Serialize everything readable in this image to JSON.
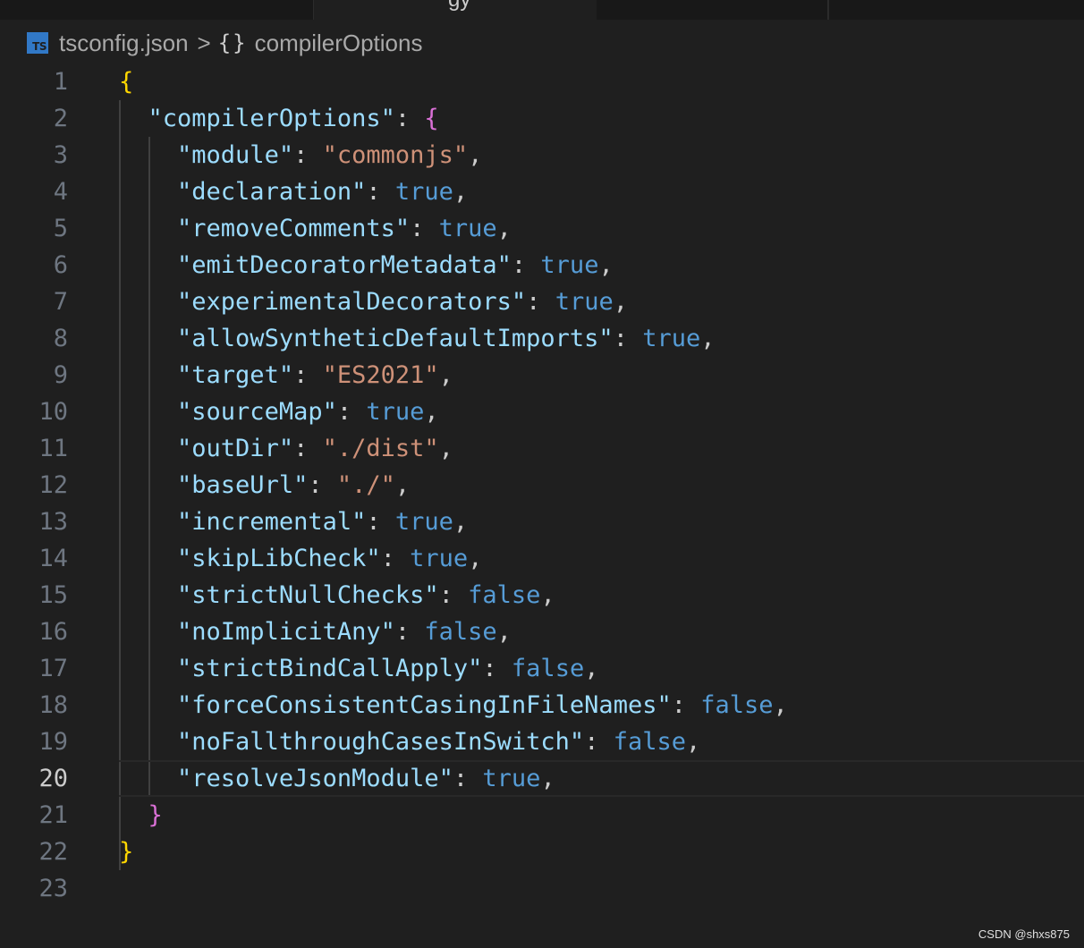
{
  "tabs": [
    {
      "label": "gy",
      "active": true
    }
  ],
  "breadcrumb": {
    "file_icon": "typescript-file-icon",
    "file_icon_text": "TS",
    "file": "tsconfig.json",
    "separator": ">",
    "symbol_icon": "braces-icon",
    "symbol_icon_text": "{}",
    "symbol": "compilerOptions"
  },
  "editor": {
    "current_line": 20,
    "lines": [
      {
        "number": "1",
        "tokens": [
          {
            "text": "{",
            "type": "b1"
          }
        ]
      },
      {
        "number": "2",
        "tokens": [
          {
            "text": "  ",
            "type": "punc"
          },
          {
            "text": "\"compilerOptions\"",
            "type": "key"
          },
          {
            "text": ": ",
            "type": "punc"
          },
          {
            "text": "{",
            "type": "b2"
          }
        ]
      },
      {
        "number": "3",
        "tokens": [
          {
            "text": "    ",
            "type": "punc"
          },
          {
            "text": "\"module\"",
            "type": "key"
          },
          {
            "text": ": ",
            "type": "punc"
          },
          {
            "text": "\"commonjs\"",
            "type": "str"
          },
          {
            "text": ",",
            "type": "punc"
          }
        ]
      },
      {
        "number": "4",
        "tokens": [
          {
            "text": "    ",
            "type": "punc"
          },
          {
            "text": "\"declaration\"",
            "type": "key"
          },
          {
            "text": ": ",
            "type": "punc"
          },
          {
            "text": "true",
            "type": "bool"
          },
          {
            "text": ",",
            "type": "punc"
          }
        ]
      },
      {
        "number": "5",
        "tokens": [
          {
            "text": "    ",
            "type": "punc"
          },
          {
            "text": "\"removeComments\"",
            "type": "key"
          },
          {
            "text": ": ",
            "type": "punc"
          },
          {
            "text": "true",
            "type": "bool"
          },
          {
            "text": ",",
            "type": "punc"
          }
        ]
      },
      {
        "number": "6",
        "tokens": [
          {
            "text": "    ",
            "type": "punc"
          },
          {
            "text": "\"emitDecoratorMetadata\"",
            "type": "key"
          },
          {
            "text": ": ",
            "type": "punc"
          },
          {
            "text": "true",
            "type": "bool"
          },
          {
            "text": ",",
            "type": "punc"
          }
        ]
      },
      {
        "number": "7",
        "tokens": [
          {
            "text": "    ",
            "type": "punc"
          },
          {
            "text": "\"experimentalDecorators\"",
            "type": "key"
          },
          {
            "text": ": ",
            "type": "punc"
          },
          {
            "text": "true",
            "type": "bool"
          },
          {
            "text": ",",
            "type": "punc"
          }
        ]
      },
      {
        "number": "8",
        "tokens": [
          {
            "text": "    ",
            "type": "punc"
          },
          {
            "text": "\"allowSyntheticDefaultImports\"",
            "type": "key"
          },
          {
            "text": ": ",
            "type": "punc"
          },
          {
            "text": "true",
            "type": "bool"
          },
          {
            "text": ",",
            "type": "punc"
          }
        ]
      },
      {
        "number": "9",
        "tokens": [
          {
            "text": "    ",
            "type": "punc"
          },
          {
            "text": "\"target\"",
            "type": "key"
          },
          {
            "text": ": ",
            "type": "punc"
          },
          {
            "text": "\"ES2021\"",
            "type": "str"
          },
          {
            "text": ",",
            "type": "punc"
          }
        ]
      },
      {
        "number": "10",
        "tokens": [
          {
            "text": "    ",
            "type": "punc"
          },
          {
            "text": "\"sourceMap\"",
            "type": "key"
          },
          {
            "text": ": ",
            "type": "punc"
          },
          {
            "text": "true",
            "type": "bool"
          },
          {
            "text": ",",
            "type": "punc"
          }
        ]
      },
      {
        "number": "11",
        "tokens": [
          {
            "text": "    ",
            "type": "punc"
          },
          {
            "text": "\"outDir\"",
            "type": "key"
          },
          {
            "text": ": ",
            "type": "punc"
          },
          {
            "text": "\"./dist\"",
            "type": "str"
          },
          {
            "text": ",",
            "type": "punc"
          }
        ]
      },
      {
        "number": "12",
        "tokens": [
          {
            "text": "    ",
            "type": "punc"
          },
          {
            "text": "\"baseUrl\"",
            "type": "key"
          },
          {
            "text": ": ",
            "type": "punc"
          },
          {
            "text": "\"./\"",
            "type": "str"
          },
          {
            "text": ",",
            "type": "punc"
          }
        ]
      },
      {
        "number": "13",
        "tokens": [
          {
            "text": "    ",
            "type": "punc"
          },
          {
            "text": "\"incremental\"",
            "type": "key"
          },
          {
            "text": ": ",
            "type": "punc"
          },
          {
            "text": "true",
            "type": "bool"
          },
          {
            "text": ",",
            "type": "punc"
          }
        ]
      },
      {
        "number": "14",
        "tokens": [
          {
            "text": "    ",
            "type": "punc"
          },
          {
            "text": "\"skipLibCheck\"",
            "type": "key"
          },
          {
            "text": ": ",
            "type": "punc"
          },
          {
            "text": "true",
            "type": "bool"
          },
          {
            "text": ",",
            "type": "punc"
          }
        ]
      },
      {
        "number": "15",
        "tokens": [
          {
            "text": "    ",
            "type": "punc"
          },
          {
            "text": "\"strictNullChecks\"",
            "type": "key"
          },
          {
            "text": ": ",
            "type": "punc"
          },
          {
            "text": "false",
            "type": "bool"
          },
          {
            "text": ",",
            "type": "punc"
          }
        ]
      },
      {
        "number": "16",
        "tokens": [
          {
            "text": "    ",
            "type": "punc"
          },
          {
            "text": "\"noImplicitAny\"",
            "type": "key"
          },
          {
            "text": ": ",
            "type": "punc"
          },
          {
            "text": "false",
            "type": "bool"
          },
          {
            "text": ",",
            "type": "punc"
          }
        ]
      },
      {
        "number": "17",
        "tokens": [
          {
            "text": "    ",
            "type": "punc"
          },
          {
            "text": "\"strictBindCallApply\"",
            "type": "key"
          },
          {
            "text": ": ",
            "type": "punc"
          },
          {
            "text": "false",
            "type": "bool"
          },
          {
            "text": ",",
            "type": "punc"
          }
        ]
      },
      {
        "number": "18",
        "tokens": [
          {
            "text": "    ",
            "type": "punc"
          },
          {
            "text": "\"forceConsistentCasingInFileNames\"",
            "type": "key"
          },
          {
            "text": ": ",
            "type": "punc"
          },
          {
            "text": "false",
            "type": "bool"
          },
          {
            "text": ",",
            "type": "punc"
          }
        ]
      },
      {
        "number": "19",
        "tokens": [
          {
            "text": "    ",
            "type": "punc"
          },
          {
            "text": "\"noFallthroughCasesInSwitch\"",
            "type": "key"
          },
          {
            "text": ": ",
            "type": "punc"
          },
          {
            "text": "false",
            "type": "bool"
          },
          {
            "text": ",",
            "type": "punc"
          }
        ]
      },
      {
        "number": "20",
        "tokens": [
          {
            "text": "    ",
            "type": "punc"
          },
          {
            "text": "\"resolveJsonModule\"",
            "type": "key"
          },
          {
            "text": ": ",
            "type": "punc"
          },
          {
            "text": "true",
            "type": "bool"
          },
          {
            "text": ",",
            "type": "punc"
          }
        ]
      },
      {
        "number": "21",
        "tokens": [
          {
            "text": "  ",
            "type": "punc"
          },
          {
            "text": "}",
            "type": "b2"
          }
        ]
      },
      {
        "number": "22",
        "tokens": [
          {
            "text": "}",
            "type": "b1"
          }
        ]
      },
      {
        "number": "23",
        "tokens": []
      }
    ]
  },
  "watermark": "CSDN @shxs875",
  "colors": {
    "background": "#1f1f1f",
    "json_key": "#9cdcfe",
    "json_string": "#ce9178",
    "json_boolean": "#569cd6",
    "bracket_level_1": "#ffd700",
    "bracket_level_2": "#da70d6",
    "line_number": "#6e7681",
    "typescript_icon": "#3178c6"
  }
}
